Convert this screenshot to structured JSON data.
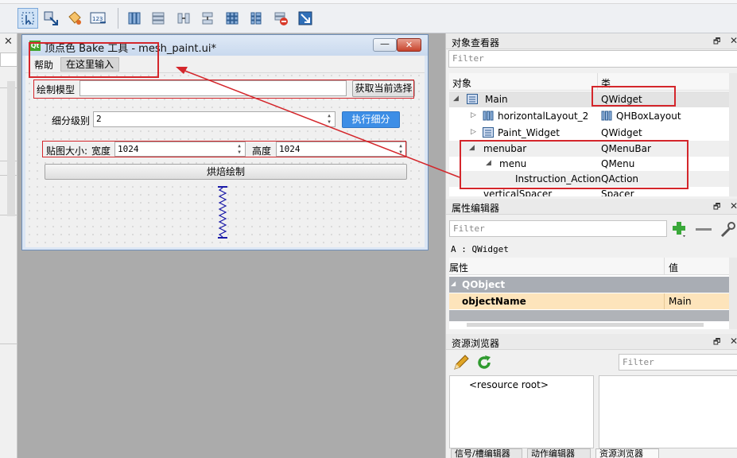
{
  "form_window": {
    "title": "顶点色 Bake 工具 - mesh_paint.ui*",
    "min_glyph": "—",
    "close_glyph": "✕",
    "menu_help": "帮助",
    "menu_type_here": "在这里输入",
    "draw_model_label": "绘制模型",
    "draw_model_value": "",
    "get_selection_button": "获取当前选择",
    "subdiv_label": "细分级别",
    "subdiv_value": "2",
    "subdiv_button": "执行细分",
    "texture_size_label": "贴图大小:",
    "width_label": "宽度",
    "width_value": "1024",
    "height_label": "高度",
    "height_value": "1024",
    "bake_button": "烘焙绘制"
  },
  "object_inspector": {
    "title": "对象查看器",
    "filter_placeholder": "Filter",
    "col_object": "对象",
    "col_class": "类",
    "rows": [
      {
        "name": "Main",
        "cls": "QWidget",
        "arrow": "◢"
      },
      {
        "name": "horizontalLayout_2",
        "cls": "QHBoxLayout",
        "arrow": "▷"
      },
      {
        "name": "Paint_Widget",
        "cls": "QWidget",
        "arrow": "▷"
      },
      {
        "name": "menubar",
        "cls": "QMenuBar",
        "arrow": "◢"
      },
      {
        "name": "menu",
        "cls": "QMenu",
        "arrow": "◢"
      },
      {
        "name": "Instruction_Action",
        "cls": "QAction",
        "arrow": ""
      },
      {
        "name": "verticalSpacer",
        "cls": "Spacer",
        "arrow": ""
      }
    ]
  },
  "property_editor": {
    "title": "属性编辑器",
    "filter_placeholder": "Filter",
    "object_line": "A : QWidget",
    "col_property": "属性",
    "col_value": "值",
    "group": "QObject",
    "prop_name": "objectName",
    "prop_value": "Main"
  },
  "resource_browser": {
    "title": "资源浏览器",
    "filter_placeholder": "Filter",
    "root_item": "<resource root>"
  },
  "bottom_tabs": [
    "信号/槽编辑器",
    "动作编辑器",
    "资源浏览器"
  ],
  "panel_glyphs": {
    "float": "🗗",
    "close": "✕"
  },
  "colors": {
    "annotation_red": "#d4262b",
    "accent_blue": "#3d8ee6"
  },
  "icons": [
    "select-tool-icon",
    "edit-signals-icon",
    "edit-buddies-icon",
    "tab-order-icon",
    "layout-horizontal-icon",
    "layout-vertical-icon",
    "layout-splitter-h-icon",
    "layout-splitter-v-icon",
    "layout-grid-icon",
    "layout-form-icon",
    "break-layout-icon",
    "adjust-size-icon"
  ]
}
